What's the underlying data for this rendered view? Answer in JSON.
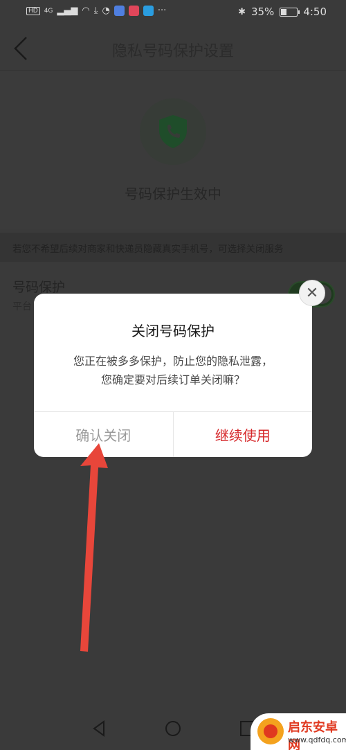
{
  "status_bar": {
    "left_badges": [
      "HD",
      "4G"
    ],
    "battery": "35%",
    "battery_fill_fraction": 0.35,
    "time": "4:50",
    "more": "···"
  },
  "header": {
    "title": "隐私号码保护设置"
  },
  "hero": {
    "status": "号码保护生效中"
  },
  "hint": "若您不希望后续对商家和快递员隐藏真实手机号，可选择关闭服务",
  "setting": {
    "title": "号码保护",
    "subtitle": "平台",
    "toggle_on": true
  },
  "dialog": {
    "title": "关闭号码保护",
    "message_line1": "您正在被多多保护，防止您的隐私泄露，",
    "message_line2": "您确定要对后续订单关闭嘛？",
    "confirm_label": "确认关闭",
    "continue_label": "继续使用"
  },
  "watermark": {
    "title": "启东安卓网",
    "url": "www.qdfdq.com"
  },
  "colors": {
    "accent_red": "#d6282b",
    "arrow_red": "#e8463a",
    "shield_green": "#1f4d2a"
  }
}
